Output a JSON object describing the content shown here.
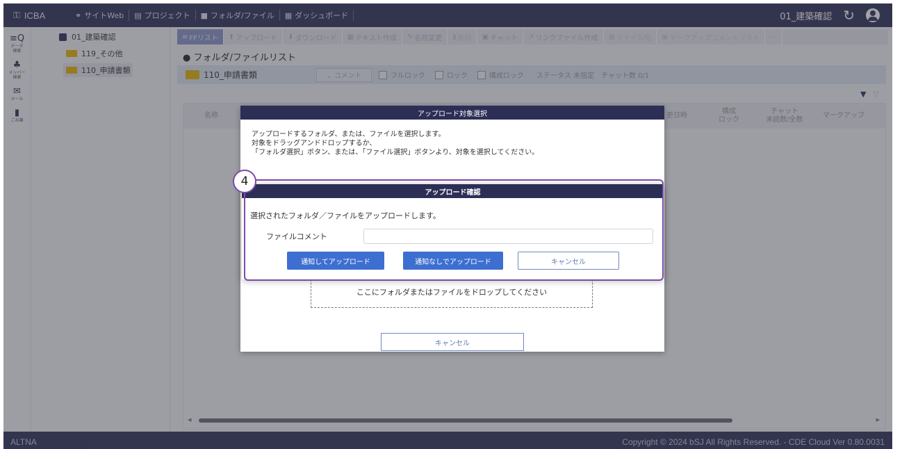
{
  "topbar": {
    "brand": "ICBA",
    "nav": [
      {
        "icon": "link-icon",
        "glyph": "⚭",
        "label": "サイトWeb"
      },
      {
        "icon": "project-icon",
        "glyph": "▤",
        "label": "プロジェクト"
      },
      {
        "icon": "folder-icon",
        "glyph": "■",
        "label": "フォルダ/ファイル"
      },
      {
        "icon": "dashboard-icon",
        "glyph": "▦",
        "label": "ダッシュボード"
      }
    ],
    "project_name": "01_建築確認"
  },
  "rail": [
    {
      "glyph": "≡Q",
      "label": "データ\n検索"
    },
    {
      "glyph": "♣",
      "label": "メンバー\n検索"
    },
    {
      "glyph": "✉",
      "label": "メール"
    },
    {
      "glyph": "▮",
      "label": "ごみ箱"
    }
  ],
  "tree": {
    "root": "01_建築確認",
    "children": [
      "119_その他",
      "110_申請書類"
    ]
  },
  "toolbar": [
    {
      "glyph": "≡",
      "label": "FFリスト",
      "state": "active"
    },
    {
      "glyph": "⬆",
      "label": "アップロード",
      "state": "normal"
    },
    {
      "glyph": "⬇",
      "label": "ダウンロード",
      "state": "normal"
    },
    {
      "glyph": "▦",
      "label": "テキスト作成",
      "state": "normal"
    },
    {
      "glyph": "✎",
      "label": "名称変更",
      "state": "normal"
    },
    {
      "glyph": "▮",
      "label": "削除",
      "state": "dim"
    },
    {
      "glyph": "▣",
      "label": "チャット",
      "state": "normal"
    },
    {
      "glyph": "↗",
      "label": "リンクファイル作成",
      "state": "normal"
    },
    {
      "glyph": "▦",
      "label": "ファイル化",
      "state": "dim"
    },
    {
      "glyph": "▣",
      "label": "マークアップコメントリスト",
      "state": "dim"
    },
    {
      "glyph": "⋯",
      "label": "",
      "state": "normal"
    }
  ],
  "section_title": "● フォルダ/ファイルリスト",
  "folderbar": {
    "name": "110_申請書類",
    "comment_label": "⌄ コメント",
    "checks": [
      "フルロック",
      "ロック",
      "構成ロック"
    ],
    "status": "ステータス 未指定　チャット数 0/1"
  },
  "table": {
    "headers": [
      "名称",
      "更日時",
      "構成\nロック",
      "チャット\n未読数/全数",
      "マークアップ"
    ]
  },
  "footer": {
    "left": "ALTNA",
    "right": "Copyright © 2024 bSJ All Rights Reserved. - CDE Cloud Ver 0.80.0031"
  },
  "upload_modal": {
    "title": "アップロード対象選択",
    "lines": [
      "アップロードするフォルダ、または、ファイルを選択します。",
      "対象をドラッグアンドドロップするか、",
      "「フォルダ選択」ボタン、または、「ファイル選択」ボタンより、対象を選択してください。"
    ],
    "dropzone_text": "ここにフォルダまたはファイルをドロップしてください",
    "cancel_label": "キャンセル"
  },
  "confirm_modal": {
    "step_number": "4",
    "title": "アップロード確認",
    "message": "選択されたフォルダ／ファイルをアップロードします。",
    "comment_label": "ファイルコメント",
    "comment_value": "",
    "buttons": {
      "notify_upload": "通知してアップロード",
      "silent_upload": "通知なしでアップロード",
      "cancel": "キャンセル"
    }
  },
  "colors": {
    "header_navy": "#2c2e56",
    "primary_blue": "#3d6fd0",
    "highlight_purple": "#7a4aa6",
    "folder_yellow": "#e6b400"
  }
}
